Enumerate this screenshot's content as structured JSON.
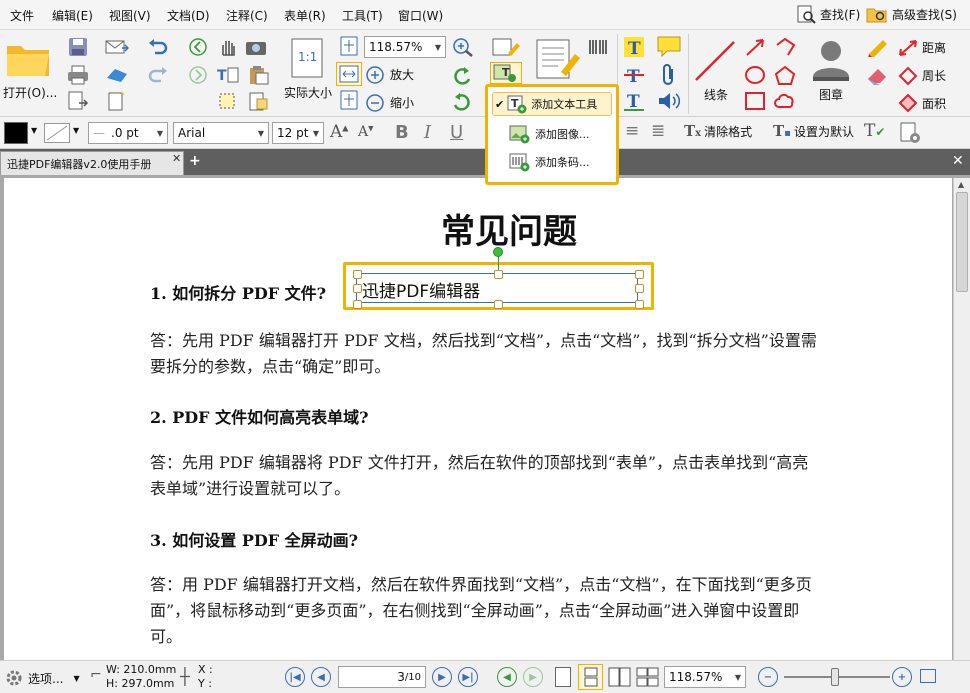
{
  "menu": [
    "文件",
    "编辑(E)",
    "视图(V)",
    "文档(D)",
    "注释(C)",
    "表单(R)",
    "工具(T)",
    "窗口(W)"
  ],
  "search": {
    "find": "查找(F)",
    "advanced": "高级查找(S)"
  },
  "ribbon": {
    "open": "打开(O)...",
    "zoom_value": "118.57%",
    "zoom_in": "放大",
    "zoom_out": "缩小",
    "actual_size": "实际大小",
    "actual_size_icon": "1:1",
    "line": "线条",
    "stamp": "图章",
    "distance": "距离",
    "perimeter": "周长",
    "area": "面积"
  },
  "format": {
    "font": "Arial",
    "size": "12 pt",
    "line_width": ".0 pt",
    "clear_format": "清除格式",
    "set_default": "设置为默认"
  },
  "tab": {
    "title": "迅捷PDF编辑器v2.0使用手册"
  },
  "dropdown": {
    "items": [
      "添加文本工具",
      "添加图像...",
      "添加条码..."
    ]
  },
  "document": {
    "heading": "常见问题",
    "q1": "1. 如何拆分 PDF 文件?",
    "textbox": "迅捷PDF编辑器",
    "a1": "答：先用 PDF 编辑器打开 PDF 文档，然后找到“文档”，点击“文档”，找到“拆分文档”设置需要拆分的参数，点击“确定”即可。",
    "q2": "2. PDF 文件如何高亮表单域?",
    "a2": "答：先用 PDF 编辑器将 PDF 文件打开，然后在软件的顶部找到“表单”，点击表单找到“高亮表单域”进行设置就可以了。",
    "q3": "3. 如何设置 PDF 全屏动画?",
    "a3": "答：用 PDF 编辑器打开文档，然后在软件界面找到“文档”，点击“文档”，在下面找到“更多页面”，将鼠标移动到“更多页面”，在右侧找到“全屏动画”，点击“全屏动画”进入弹窗中设置即可。"
  },
  "status": {
    "options": "选项...",
    "width": "W: 210.0mm",
    "height": "H: 297.0mm",
    "x": "X :",
    "y": "Y :",
    "page_current": "3",
    "page_total": "/10",
    "zoom": "118.57%"
  },
  "colors": {
    "accent": "#f0b400",
    "blue": "#3a6fb0",
    "red": "#e0222a"
  }
}
